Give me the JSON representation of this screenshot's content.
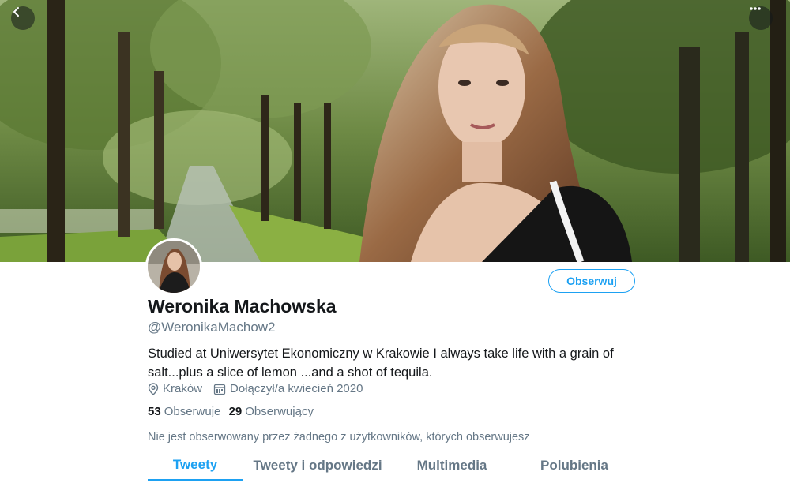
{
  "colors": {
    "accent": "#1da1f2",
    "text": "#14171a",
    "muted": "#657786"
  },
  "header": {
    "back_icon": "arrow-left-icon",
    "more_icon": "ellipsis-icon"
  },
  "profile": {
    "name": "Weronika Machowska",
    "handle": "@WeronikaMachow2",
    "bio": "Studied at Uniwersytet Ekonomiczny w Krakowie I always take life with a grain of salt...plus a slice of lemon ...and a shot of tequila.",
    "location": "Kraków",
    "joined": "Dołączył/a kwiecień 2020",
    "follow_label": "Obserwuj"
  },
  "stats": {
    "following_count": "53",
    "following_label": "Obserwuje",
    "followers_count": "29",
    "followers_label": "Obserwujący"
  },
  "followed_note": "Nie jest obserwowany przez żadnego z użytkowników, których obserwujesz",
  "tabs": [
    {
      "label": "Tweety",
      "active": true
    },
    {
      "label": "Tweety i odpowiedzi",
      "active": false
    },
    {
      "label": "Multimedia",
      "active": false
    },
    {
      "label": "Polubienia",
      "active": false
    }
  ]
}
